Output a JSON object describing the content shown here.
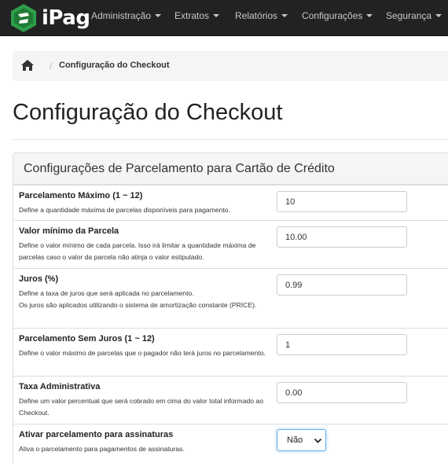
{
  "brand": {
    "name": "iPag"
  },
  "nav": [
    {
      "label": "Administração"
    },
    {
      "label": "Extratos"
    },
    {
      "label": "Relatórios"
    },
    {
      "label": "Configurações"
    },
    {
      "label": "Segurança"
    }
  ],
  "breadcrumb": {
    "separator": "/",
    "current": "Configuração do Checkout"
  },
  "page": {
    "title": "Configuração do Checkout"
  },
  "panel": {
    "title": "Configurações de Parcelamento para Cartão de Crédito",
    "fields": [
      {
        "label": "Parcelamento Máximo (1 ~ 12)",
        "desc": "Define a quantidade máxima de parcelas disponíveis para pagamento.",
        "value": "10"
      },
      {
        "label": "Valor mínimo da Parcela",
        "desc": "Define o valor mínimo de cada parcela. Isso irá limitar a quantidade máxima de parcelas caso o valor da parcela não atinja o valor estipulado.",
        "value": "10.00"
      },
      {
        "label": "Juros (%)",
        "desc": "Define a taxa de juros que será aplicada no parcelamento.",
        "desc2": "Os juros são aplicados utilizando o sistema de amortização constante (PRICE).",
        "value": "0.99"
      },
      {
        "label": "Parcelamento Sem Juros (1 ~ 12)",
        "desc": "Define o valor máximo de parcelas que o pagador não terá juros no parcelamento.",
        "value": "1"
      },
      {
        "label": "Taxa Administrativa",
        "desc": "Define um valor percentual que será cobrado em cima do valor total informado ao Checkout.",
        "value": "0.00"
      },
      {
        "label": "Ativar parcelamento para assinaturas",
        "desc": "Ativa o parcelamento para pagamentos de assinaturas.",
        "selected": "Não"
      }
    ]
  },
  "colors": {
    "navbar": "#222222",
    "brand_green": "#2e9e4a",
    "focus": "#66afe9"
  },
  "icons": {
    "logo": "ipag-logo-icon",
    "home": "home-icon",
    "caret": "caret-down-icon",
    "chevron": "chevron-down-icon"
  }
}
